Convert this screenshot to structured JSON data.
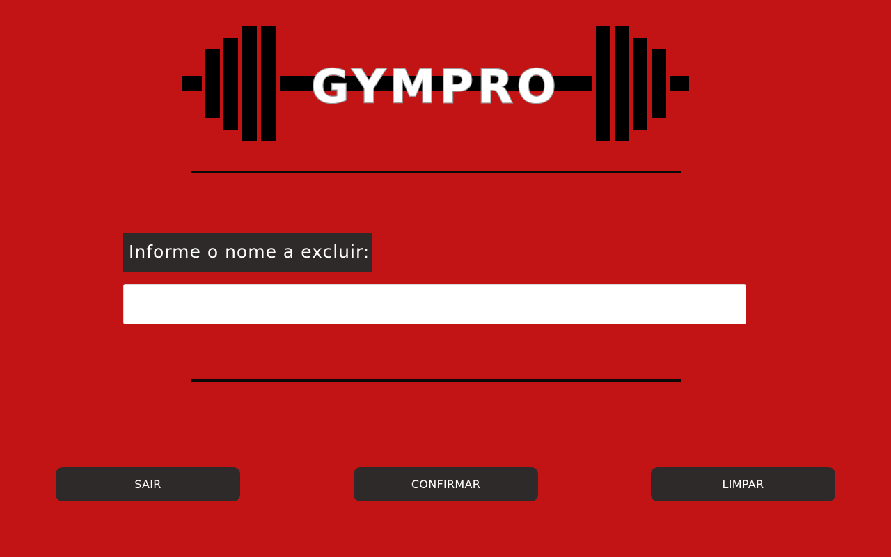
{
  "app": {
    "logo_text": "GYMPRO",
    "icon": "barbell-icon"
  },
  "form": {
    "prompt_label": "Informe o nome a excluir:",
    "name_input_value": "",
    "name_input_placeholder": ""
  },
  "actions": {
    "exit_label": "SAIR",
    "confirm_label": "CONFIRMAR",
    "clear_label": "LIMPAR"
  },
  "colors": {
    "background": "#c21414",
    "panel": "#2e2a2a",
    "divider": "#0a0a0a",
    "logo_text_fill": "#ffffff",
    "logo_text_outline": "#9a9a9a"
  }
}
